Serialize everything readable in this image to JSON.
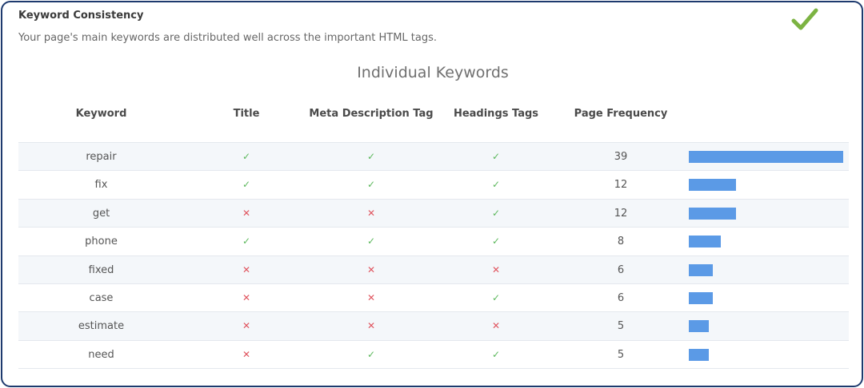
{
  "header": {
    "title": "Keyword Consistency",
    "description": "Your page's main keywords are distributed well across the important HTML tags.",
    "status_icon": "check-icon",
    "status_color": "#7cb342"
  },
  "section_title": "Individual Keywords",
  "columns": {
    "keyword": "Keyword",
    "title": "Title",
    "meta": "Meta Description Tag",
    "headings": "Headings Tags",
    "frequency": "Page Frequency"
  },
  "marks": {
    "yes": "✓",
    "no": "✕"
  },
  "colors": {
    "yes": "#5cb85c",
    "no": "#e0555f",
    "bar": "#5b9ae6"
  },
  "max_frequency": 39,
  "rows": [
    {
      "keyword": "repair",
      "title": true,
      "meta": true,
      "headings": true,
      "frequency": 39
    },
    {
      "keyword": "fix",
      "title": true,
      "meta": true,
      "headings": true,
      "frequency": 12
    },
    {
      "keyword": "get",
      "title": false,
      "meta": false,
      "headings": true,
      "frequency": 12
    },
    {
      "keyword": "phone",
      "title": true,
      "meta": true,
      "headings": true,
      "frequency": 8
    },
    {
      "keyword": "fixed",
      "title": false,
      "meta": false,
      "headings": false,
      "frequency": 6
    },
    {
      "keyword": "case",
      "title": false,
      "meta": false,
      "headings": true,
      "frequency": 6
    },
    {
      "keyword": "estimate",
      "title": false,
      "meta": false,
      "headings": false,
      "frequency": 5
    },
    {
      "keyword": "need",
      "title": false,
      "meta": true,
      "headings": true,
      "frequency": 5
    }
  ]
}
